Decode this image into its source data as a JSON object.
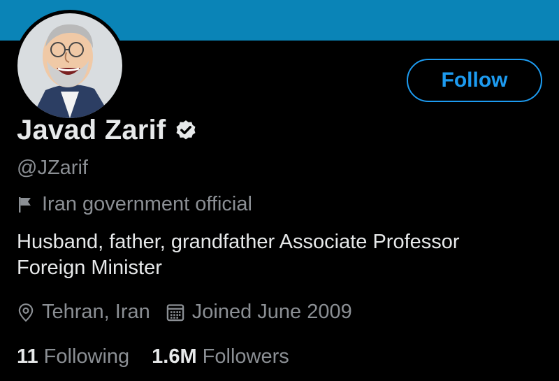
{
  "colors": {
    "banner": "#0a84b7",
    "background": "#000000",
    "accent": "#1d9bf0",
    "text_primary": "#e7e9ea",
    "text_secondary": "#8b8f94"
  },
  "profile": {
    "name": "Javad Zarif",
    "handle": "@JZarif",
    "verified_icon": "verified-badge-icon",
    "label_icon": "flag-icon",
    "label": "Iran government official",
    "bio_lines": [
      "Husband, father, grandfather Associate Professor",
      "Foreign Minister"
    ],
    "location_icon": "location-pin-icon",
    "location": "Tehran, Iran",
    "joined_icon": "calendar-icon",
    "joined": "Joined June 2009"
  },
  "actions": {
    "follow_label": "Follow"
  },
  "stats": {
    "following_count": "11",
    "following_label": "Following",
    "followers_count": "1.6M",
    "followers_label": "Followers"
  }
}
